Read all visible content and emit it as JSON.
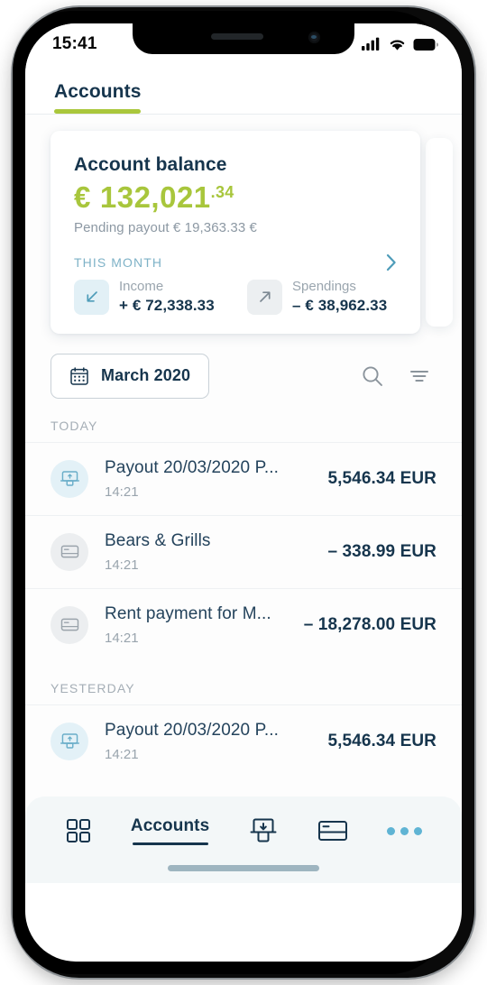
{
  "status_bar": {
    "time": "15:41",
    "signal_icon": "cellular-signal-icon",
    "wifi_icon": "wifi-icon",
    "battery_icon": "battery-icon"
  },
  "header": {
    "tabs": [
      {
        "label": "Accounts",
        "active": true
      }
    ]
  },
  "balance_card": {
    "title": "Account balance",
    "currency_symbol": "€",
    "amount_main": "132,021",
    "amount_cents": ".34",
    "pending_label": "Pending payout € 19,363.33 €",
    "month_label": "THIS MONTH",
    "chevron_icon": "chevron-right-icon",
    "stats": [
      {
        "name": "Income",
        "value": "+ € 72,338.33",
        "icon": "arrow-down-left-icon"
      },
      {
        "name": "Spendings",
        "value": "– € 38,962.33",
        "icon": "arrow-up-right-icon"
      }
    ]
  },
  "filter_row": {
    "date_chip_label": "March 2020",
    "calendar_icon": "calendar-icon",
    "search_icon": "search-icon",
    "filter_icon": "filter-icon"
  },
  "transactions": {
    "groups": [
      {
        "day_label": "TODAY",
        "rows": [
          {
            "icon": "payout-atm-icon",
            "icon_kind": "payout",
            "title": "Payout 20/03/2020 P...",
            "time": "14:21",
            "amount": "5,546.34 EUR"
          },
          {
            "icon": "card-icon",
            "icon_kind": "card",
            "title": "Bears & Grills",
            "time": "14:21",
            "amount": "– 338.99 EUR"
          },
          {
            "icon": "card-icon",
            "icon_kind": "card",
            "title": "Rent payment for M...",
            "time": "14:21",
            "amount": "– 18,278.00 EUR"
          }
        ]
      },
      {
        "day_label": "YESTERDAY",
        "rows": [
          {
            "icon": "payout-atm-icon",
            "icon_kind": "payout",
            "title": "Payout 20/03/2020 P...",
            "time": "14:21",
            "amount": "5,546.34 EUR"
          }
        ]
      }
    ]
  },
  "bottom_nav": {
    "items": [
      {
        "icon": "grid-dashboard-icon",
        "label": ""
      },
      {
        "icon": "",
        "label": "Accounts",
        "active": true
      },
      {
        "icon": "payout-atm-icon",
        "label": ""
      },
      {
        "icon": "card-icon",
        "label": ""
      },
      {
        "icon": "more-dots-icon",
        "label": ""
      }
    ]
  },
  "colors": {
    "accent_green": "#a8c63c",
    "navy": "#16354d",
    "teal": "#7eb2c7",
    "muted": "#99a4ad",
    "nav_bg": "#f3f7f8"
  }
}
